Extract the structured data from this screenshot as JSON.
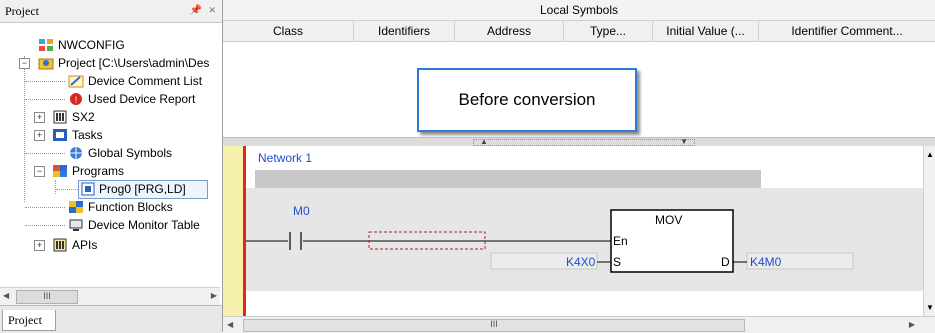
{
  "project_pane": {
    "title": "Project",
    "pin_glyph": "ɨ",
    "close_glyph": "×",
    "tab_label": "Project",
    "scroll_thumb": "III",
    "tree": [
      {
        "label": "NWCONFIG",
        "icon": "network-config-icon"
      },
      {
        "label": "Project [C:\\Users\\admin\\Des",
        "icon": "project-icon",
        "expander": "−"
      },
      {
        "label": "Device Comment List",
        "icon": "comment-list-icon"
      },
      {
        "label": "Used Device Report",
        "icon": "device-report-icon"
      },
      {
        "label": "SX2",
        "icon": "plc-icon",
        "expander": "+"
      },
      {
        "label": "Tasks",
        "icon": "tasks-icon",
        "expander": "+"
      },
      {
        "label": "Global Symbols",
        "icon": "global-symbols-icon"
      },
      {
        "label": "Programs",
        "icon": "programs-icon",
        "expander": "−"
      },
      {
        "label": "Prog0 [PRG,LD]",
        "icon": "program-file-icon"
      },
      {
        "label": "Function Blocks",
        "icon": "function-blocks-icon"
      },
      {
        "label": "Device Monitor Table",
        "icon": "monitor-table-icon"
      },
      {
        "label": "APIs",
        "icon": "apis-icon",
        "expander": "+"
      }
    ]
  },
  "local_symbols": {
    "title": "Local Symbols",
    "columns": [
      "Class",
      "Identifiers",
      "Address",
      "Type...",
      "Initial Value (...",
      "Identifier Comment..."
    ]
  },
  "callout": {
    "text": "Before conversion",
    "border_color": "#2f7bd8"
  },
  "ladder": {
    "network_label": "Network 1",
    "contact_label": "M0",
    "instruction": "MOV",
    "pin_en": "En",
    "pin_s": "S",
    "pin_d": "D",
    "operand_s": "K4X0",
    "operand_d": "K4M0",
    "label_color": "#1f4fcf",
    "rail_color": "#e0261f"
  },
  "scroll": {
    "h_thumb": "III",
    "up_arrow": "▲",
    "down_arrow": "▼",
    "left_arrow": "◀",
    "right_arrow": "▶"
  }
}
